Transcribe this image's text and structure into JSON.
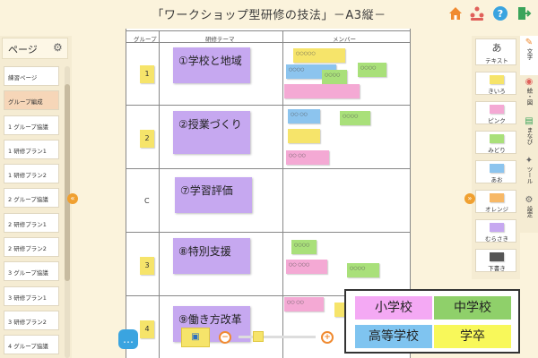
{
  "header": {
    "title": "「ワークショップ型研修の技法」－A3縦－"
  },
  "header_icons": [
    "home-icon",
    "people-icon",
    "help-icon",
    "exit-icon"
  ],
  "left_panel": {
    "title": "ページ",
    "items": [
      "練習ページ",
      "グループ編成",
      "1 グループ協議",
      "1 研修プラン1",
      "1 研修プラン2",
      "2 グループ協議",
      "2 研修プラン1",
      "2 研修プラン2",
      "3 グループ協議",
      "3 研修プラン1",
      "3 研修プラン2",
      "4 グループ協議"
    ],
    "active_index": 1
  },
  "sheet": {
    "headers": {
      "group": "グループ",
      "theme": "研修テーマ",
      "member": "メンバー"
    },
    "rows": [
      {
        "group": "1",
        "theme": "①学校と地域"
      },
      {
        "group": "2",
        "theme": "②授業づくり"
      },
      {
        "group": "C",
        "theme": "⑦学習評価"
      },
      {
        "group": "3",
        "theme": "⑧特別支援"
      },
      {
        "group": "4",
        "theme": "⑨働き方改革"
      }
    ]
  },
  "member_notes": [
    {
      "color": "#f6e46a",
      "text": "○○○○○"
    },
    {
      "color": "#8cc4ee",
      "text": "○○○○"
    },
    {
      "color": "#a9e07a",
      "text": "○○○○"
    },
    {
      "color": "#a9e07a",
      "text": "○○○○"
    },
    {
      "color": "#f4a9d4",
      "text": ""
    },
    {
      "color": "#8cc4ee",
      "text": "○○ ○○"
    },
    {
      "color": "#a9e07a",
      "text": "○○○○"
    },
    {
      "color": "#f6e46a",
      "text": ""
    },
    {
      "color": "#f4a9d4",
      "text": "○○ ○○"
    },
    {
      "color": "#a9e07a",
      "text": "○○○○"
    },
    {
      "color": "#f4a9d4",
      "text": "○○ ○○○"
    },
    {
      "color": "#a9e07a",
      "text": "○○○○"
    },
    {
      "color": "#f4a9d4",
      "text": "○○ ○○"
    },
    {
      "color": "#f6e46a",
      "text": ""
    }
  ],
  "sticky_tools": {
    "text_tool": {
      "glyph": "あ",
      "label": "テキスト"
    },
    "notes": [
      {
        "label": "きいろ",
        "color": "#f6e46a"
      },
      {
        "label": "ピンク",
        "color": "#f4a9d4"
      },
      {
        "label": "みどり",
        "color": "#a9e07a"
      },
      {
        "label": "あお",
        "color": "#8cc4ee"
      },
      {
        "label": "オレンジ",
        "color": "#f7b866"
      },
      {
        "label": "むらさき",
        "color": "#c6a8f0"
      },
      {
        "label": "下書き",
        "color": "#555555"
      }
    ]
  },
  "side_tabs": [
    {
      "label": "文字",
      "icon": "pencil-icon"
    },
    {
      "label": "絵・図",
      "icon": "palette-icon"
    },
    {
      "label": "まなび",
      "icon": "book-icon"
    },
    {
      "label": "ツール",
      "icon": "wrench-icon"
    },
    {
      "label": "設定",
      "icon": "gear-icon"
    }
  ],
  "legend": [
    {
      "label": "小学校",
      "color": "#f4a9f4"
    },
    {
      "label": "中学校",
      "color": "#8fd06a"
    },
    {
      "label": "高等学校",
      "color": "#7fc4f0"
    },
    {
      "label": "学卒",
      "color": "#f8f85a"
    }
  ]
}
